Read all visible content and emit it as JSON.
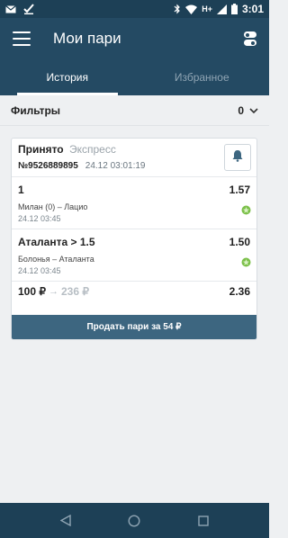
{
  "status_bar": {
    "time": "3:01",
    "network": "H+",
    "icons": [
      "mail-icon",
      "checkmark-icon",
      "bluetooth-icon",
      "wifi-icon",
      "signal-icon",
      "battery-icon"
    ]
  },
  "app_bar": {
    "title": "Мои пари",
    "menu_icon": "hamburger-menu-icon",
    "settings_icon": "toggle-settings-icon"
  },
  "tabs": [
    {
      "label": "История",
      "active": true
    },
    {
      "label": "Избранное",
      "active": false
    }
  ],
  "filters": {
    "label": "Фильтры",
    "count": "0"
  },
  "bet": {
    "status": "Принято",
    "type": "Экспресс",
    "id": "№9526889895",
    "date": "24.12 03:01:19",
    "bell_icon": "bell-icon",
    "events": [
      {
        "outcome": "1",
        "odds": "1.57",
        "match": "Милан (0) – Лацио",
        "date": "24.12 03:45",
        "result_icon": "win-icon"
      },
      {
        "outcome": "Аталанта > 1.5",
        "odds": "1.50",
        "match": "Болонья – Аталанта",
        "date": "24.12 03:45",
        "result_icon": "win-icon"
      }
    ],
    "stake": "100 ₽",
    "arrow": "→",
    "payout": "236 ₽",
    "total_odds": "2.36",
    "sell_label": "Продать пари за 54 ₽"
  },
  "colors": {
    "primary": "#244a63",
    "status_bar": "#1d4056",
    "button": "#3d6680",
    "win": "#7cc04a"
  },
  "nav_bar": {
    "icons": [
      "back-icon",
      "home-icon",
      "recents-icon"
    ]
  }
}
